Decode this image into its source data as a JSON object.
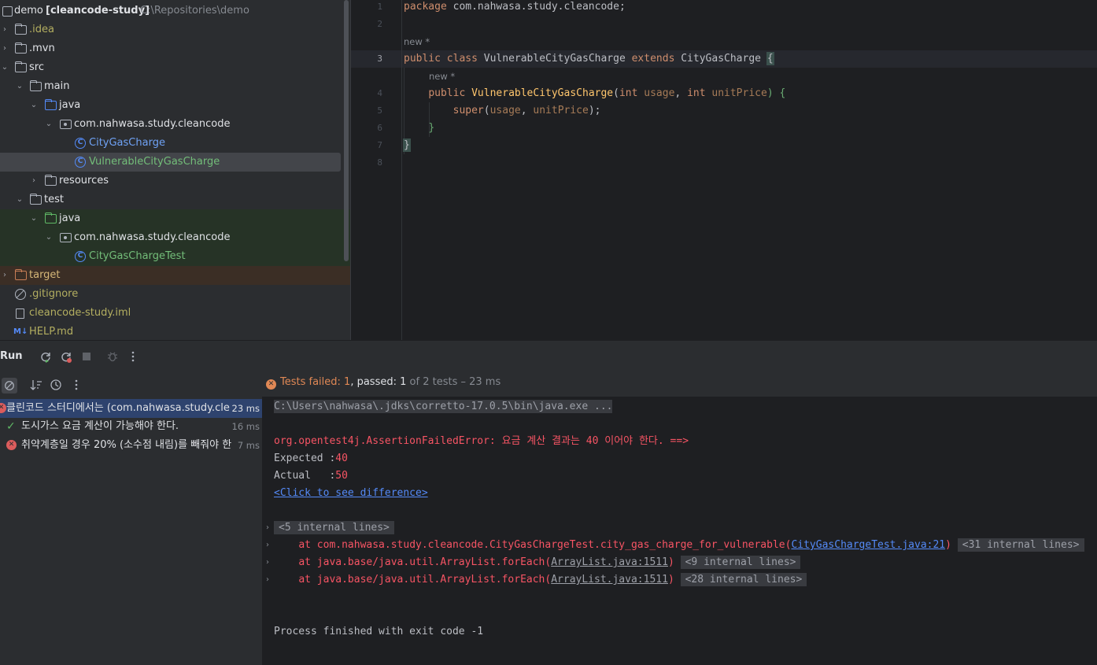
{
  "project": {
    "root_name": "demo",
    "root_module": "[cleancode-study]",
    "root_path": "C:\\Repositories\\demo",
    "items": [
      {
        "label": ".idea"
      },
      {
        "label": ".mvn"
      },
      {
        "label": "src"
      },
      {
        "label": "main"
      },
      {
        "label": "java"
      },
      {
        "label": "com.nahwasa.study.cleancode"
      },
      {
        "label": "CityGasCharge"
      },
      {
        "label": "VulnerableCityGasCharge"
      },
      {
        "label": "resources"
      },
      {
        "label": "test"
      },
      {
        "label": "java"
      },
      {
        "label": "com.nahwasa.study.cleancode"
      },
      {
        "label": "CityGasChargeTest"
      },
      {
        "label": "target"
      },
      {
        "label": ".gitignore"
      },
      {
        "label": "cleancode-study.iml"
      },
      {
        "label": "HELP.md"
      }
    ],
    "class_icon_letter": "C",
    "md_icon_text": "M↓"
  },
  "editor": {
    "line_numbers": [
      "1",
      "2",
      "3",
      "4",
      "5",
      "6",
      "7",
      "8"
    ],
    "hint_new": "new *",
    "line1": {
      "kw": "package",
      "rest": " com.nahwasa.study.cleancode;"
    },
    "line3": {
      "kw1": "public",
      "kw2": "class",
      "name": "VulnerableCityGasCharge",
      "kw3": "extends",
      "parent": "CityGasCharge",
      "brace": "{"
    },
    "line4": {
      "kw1": "public",
      "name": "VulnerableCityGasCharge",
      "open": "(",
      "t1": "int",
      "p1": "usage",
      "comma": ", ",
      "t2": "int",
      "p2": "unitPrice",
      "close": ") {"
    },
    "line5": {
      "call": "super",
      "open": "(",
      "p1": "usage",
      "comma": ", ",
      "p2": "unitPrice",
      "close": ");"
    },
    "line6": {
      "brace": "}"
    },
    "line7": {
      "brace": "}"
    }
  },
  "run": {
    "title": "Run",
    "status": {
      "failed_label": "Tests failed: ",
      "failed": "1",
      "passed_label": ", passed: ",
      "passed": "1",
      "of": " of 2 tests – 23 ms"
    },
    "tests": [
      {
        "label": "클린코드 스터디에서는 (com.nahwasa.study.cle",
        "time": "23 ms",
        "status": "failed"
      },
      {
        "label": "도시가스 요금 계산이 가능해야 한다.",
        "time": "16 ms",
        "status": "passed"
      },
      {
        "label": "취약계층일 경우 20% (소수점 내림)를 빼줘야 한",
        "time": "7 ms",
        "status": "failed"
      }
    ],
    "console": {
      "cmd": "C:\\Users\\nahwasa\\.jdks\\corretto-17.0.5\\bin\\java.exe ...",
      "error": "org.opentest4j.AssertionFailedError: 요금 계산 결과는 40 이어야 한다. ==>",
      "expected_label": "Expected :",
      "expected_value": "40",
      "actual_label": "Actual   :",
      "actual_value": "50",
      "diff_link": "<Click to see difference>",
      "fold1": "<5 internal lines>",
      "trace1_pre": "at com.nahwasa.study.cleancode.CityGasChargeTest.city_gas_charge_for_vulnerable(",
      "trace1_link": "CityGasChargeTest.java:21",
      "trace1_post": ")",
      "trace1_fold": "<31 internal lines>",
      "trace2_pre": "at java.base/java.util.ArrayList.forEach(",
      "trace2_link": "ArrayList.java:1511",
      "trace2_post": ")",
      "trace2_fold": "<9 internal lines>",
      "trace3_pre": "at java.base/java.util.ArrayList.forEach(",
      "trace3_link": "ArrayList.java:1511",
      "trace3_post": ")",
      "trace3_fold": "<28 internal lines>",
      "exit": "Process finished with exit code -1"
    }
  },
  "icons": {
    "chevron_right": "›",
    "chevron_down": "⌄",
    "check": "✓",
    "cross": "✕",
    "warn": "✕",
    "fold_arrow": "›"
  },
  "colors": {
    "accent": "#548af7",
    "error": "#f75464",
    "success": "#5fb865",
    "selection": "#2e436e"
  }
}
